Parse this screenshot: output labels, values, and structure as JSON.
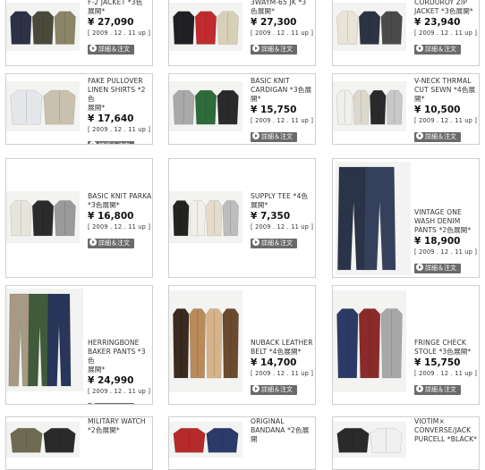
{
  "products": [
    {
      "title": "F-2 JACKET *3色\n展開*",
      "price": "¥ 27,090",
      "date": "[ 2009 . 12 . 11 up ]",
      "button": "詳細＆注文",
      "colors": [
        "#2c3145",
        "#4a4a3a",
        "#8a8566"
      ]
    },
    {
      "title": "3WAYM-65 JK *3\n色展開*",
      "price": "¥ 27,300",
      "date": "[ 2009 . 12 . 11 up ]",
      "button": "詳細＆注文",
      "colors": [
        "#1f1f24",
        "#c12a2e",
        "#d8cfb8"
      ]
    },
    {
      "title": "CORDUROY ZIP\nJACKET *3色展開*",
      "price": "¥ 23,940",
      "date": "[ 2009 . 12 . 11 up ]",
      "button": "詳細＆注文",
      "colors": [
        "#e8e4d8",
        "#2d3245",
        "#4a4a4a"
      ]
    },
    {
      "title": "FAKE PULLOVER\nLINEN SHIRTS *2色\n展開*",
      "price": "¥ 17,640",
      "date": "[ 2009 . 12 . 11 up ]",
      "button": "詳細＆注文",
      "colors": [
        "#e6e7ea",
        "#c9c0ad"
      ]
    },
    {
      "title": "BASIC KNIT\nCARDIGAN *3色展\n開*",
      "price": "¥ 15,750",
      "date": "[ 2009 . 12 . 11 up ]",
      "button": "詳細＆注文",
      "colors": [
        "#a9a9a9",
        "#2e6b3a",
        "#2a2a2a"
      ]
    },
    {
      "title": "V-NECK THRMAL\nCUT SEWN *4色展\n開*",
      "price": "¥ 10,500",
      "date": "[ 2009 . 12 . 11 up ]",
      "button": "詳細＆注文",
      "colors": [
        "#efefec",
        "#dcd8cc",
        "#2a2a2a",
        "#c8c8c8"
      ]
    },
    {
      "title": "BASIC KNIT PARKA\n*3色展開*",
      "price": "¥ 16,800",
      "date": "[ 2009 . 12 . 11 up ]",
      "button": "詳細＆注文",
      "colors": [
        "#e7e4dc",
        "#2b2b2b",
        "#9a9a9a"
      ]
    },
    {
      "title": "SUPPLY TEE *4色\n展開*",
      "price": "¥ 7,350",
      "date": "[ 2009 . 12 . 11 up ]",
      "button": "詳細＆注文",
      "colors": [
        "#23231f",
        "#f1efe8",
        "#e4ddcc",
        "#bdbdbd"
      ]
    },
    {
      "title": "VINTAGE ONE\nWASH DENIM\nPANTS *2色展開*",
      "price": "¥ 18,900",
      "date": "[ 2009 . 12 . 11 up ]",
      "button": "詳細＆注文",
      "colors": [
        "#2a3347",
        "#35415c"
      ]
    },
    {
      "title": "HERRINGBONE\nBAKER PANTS *3色\n展開*",
      "price": "¥ 24,990",
      "date": "[ 2009 . 12 . 11 up ]",
      "button": "詳細＆注文",
      "colors": [
        "#a69a85",
        "#3f5b3a",
        "#27365a"
      ]
    },
    {
      "title": "NUBACK LEATHER\nBELT *4色展開*",
      "price": "¥ 14,700",
      "date": "[ 2009 . 12 . 11 up ]",
      "button": "詳細＆注文",
      "colors": [
        "#3a2a20",
        "#b98a5a",
        "#d7b38a",
        "#6b4a2f"
      ]
    },
    {
      "title": "FRINGE CHECK\nSTOLE *3色展開*",
      "price": "¥ 15,750",
      "date": "[ 2009 . 12 . 11 up ]",
      "button": "詳細＆注文",
      "colors": [
        "#2e3a66",
        "#8a2a2a",
        "#a7a7a7"
      ]
    },
    {
      "title": "MILITARY WATCH\n*2色展開*",
      "price": "",
      "date": "",
      "button": "",
      "colors": [
        "#6f6a52",
        "#2a2a2a"
      ]
    },
    {
      "title": "ORIGINAL\nBANDANA *2色展開",
      "price": "",
      "date": "",
      "button": "",
      "colors": [
        "#b52a2a",
        "#2a3a6a"
      ]
    },
    {
      "title": "VIOTIM×\nCONVERSE/JACK\nPURCELL *BLACK*",
      "price": "",
      "date": "",
      "button": "",
      "colors": [
        "#2a2a2a",
        "#f0f0f0"
      ]
    }
  ]
}
